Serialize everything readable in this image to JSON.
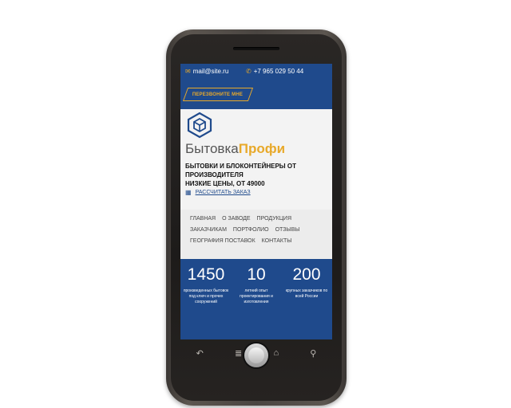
{
  "topbar": {
    "email": "mail@site.ru",
    "email_icon": "mail-icon",
    "phone": "+7 965 029 50 44",
    "phone_icon": "phone-icon",
    "callback_label": "ПЕРЕЗВОНИТЕ МНЕ"
  },
  "hero": {
    "logo_part1": "Бытовка",
    "logo_part2": "Профи",
    "headline_line1": "БЫТОВКИ И БЛОКОНТЕЙНЕРЫ ОТ",
    "headline_line2": "ПРОИЗВОДИТЕЛЯ",
    "headline_line3": "НИЗКИЕ ЦЕНЫ, ОТ 49000",
    "order_label": "РАССЧИТАТЬ ЗАКАЗ",
    "order_icon": "calculator-icon"
  },
  "nav": {
    "items": [
      "ГЛАВНАЯ",
      "О ЗАВОДЕ",
      "ПРОДУКЦИЯ",
      "ЗАКАЗЧИКАМ",
      "ПОРТФОЛИО",
      "ОТЗЫВЫ",
      "ГЕОГРАФИЯ ПОСТАВОК",
      "КОНТАКТЫ"
    ]
  },
  "stats": [
    {
      "number": "1450",
      "desc": "произведенных бытовок под ключ и прочих сооружений"
    },
    {
      "number": "10",
      "desc": "летний опыт проектирования и изготовления"
    },
    {
      "number": "200",
      "desc": "крупных заказчиков по всей России"
    }
  ],
  "device": {
    "keys": [
      "back-icon",
      "menu-icon",
      "home-icon",
      "search-icon"
    ]
  },
  "colors": {
    "brand_blue": "#1f4a8c",
    "accent_orange": "#e8a92a"
  }
}
